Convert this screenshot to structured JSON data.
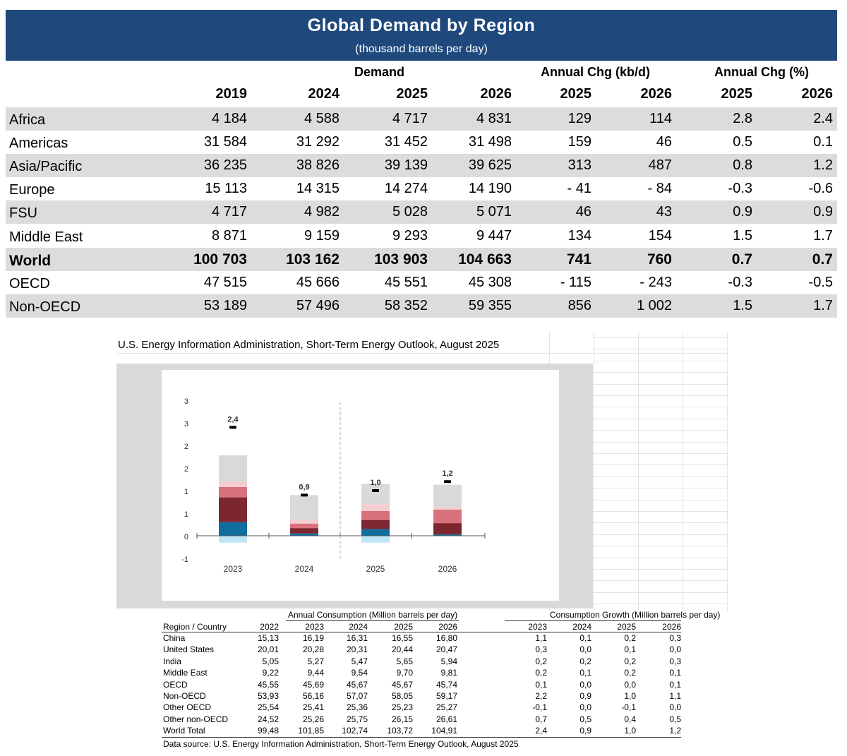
{
  "header": {
    "title": "Global Demand by Region",
    "subtitle": "(thousand barrels per day)"
  },
  "table": {
    "groups": [
      "Demand",
      "Annual Chg (kb/d)",
      "Annual Chg (%)"
    ],
    "years": [
      "2019",
      "2024",
      "2025",
      "2026",
      "2025",
      "2026",
      "2025",
      "2026"
    ],
    "rows": [
      {
        "name": "Africa",
        "vals": [
          "4 184",
          "4 588",
          "4 717",
          "4 831",
          "129",
          "114",
          "2.8",
          "2.4"
        ],
        "shade": true,
        "bold": false
      },
      {
        "name": "Americas",
        "vals": [
          "31 584",
          "31 292",
          "31 452",
          "31 498",
          "159",
          "46",
          "0.5",
          "0.1"
        ],
        "shade": false,
        "bold": false
      },
      {
        "name": "Asia/Pacific",
        "vals": [
          "36 235",
          "38 826",
          "39 139",
          "39 625",
          "313",
          "487",
          "0.8",
          "1.2"
        ],
        "shade": true,
        "bold": false
      },
      {
        "name": "Europe",
        "vals": [
          "15 113",
          "14 315",
          "14 274",
          "14 190",
          "- 41",
          "- 84",
          "-0.3",
          "-0.6"
        ],
        "shade": false,
        "bold": false
      },
      {
        "name": "FSU",
        "vals": [
          "4 717",
          "4 982",
          "5 028",
          "5 071",
          "46",
          "43",
          "0.9",
          "0.9"
        ],
        "shade": true,
        "bold": false
      },
      {
        "name": "Middle East",
        "vals": [
          "8 871",
          "9 159",
          "9 293",
          "9 447",
          "134",
          "154",
          "1.5",
          "1.7"
        ],
        "shade": false,
        "bold": false
      },
      {
        "name": "World",
        "vals": [
          "100 703",
          "103 162",
          "103 903",
          "104 663",
          "741",
          "760",
          "0.7",
          "0.7"
        ],
        "shade": true,
        "bold": true
      },
      {
        "name": "OECD",
        "vals": [
          "47 515",
          "45 666",
          "45 551",
          "45 308",
          "- 115",
          "- 243",
          "-0.3",
          "-0.5"
        ],
        "shade": false,
        "bold": false
      },
      {
        "name": "Non-OECD",
        "vals": [
          "53 189",
          "57 496",
          "58 352",
          "59 355",
          "856",
          "1 002",
          "1.5",
          "1.7"
        ],
        "shade": true,
        "bold": false
      }
    ]
  },
  "source_title": "U.S. Energy Information Administration, Short-Term Energy Outlook, August 2025",
  "chart_data": {
    "type": "bar",
    "stacked": true,
    "categories": [
      "2023",
      "2024",
      "2025",
      "2026"
    ],
    "y_tick_labels": [
      "3",
      "3",
      "2",
      "2",
      "1",
      "1",
      "0",
      "-1"
    ],
    "ylim": [
      -0.5,
      3.0
    ],
    "forecast_divider_after": "2024",
    "series_colors": [
      "#bfe6f7",
      "#0f6e9e",
      "#7b2631",
      "#d9717c",
      "#f3cdd2",
      "#d9d9d9"
    ],
    "stacks": [
      [
        -0.15,
        0.3,
        0.55,
        0.23,
        0.12,
        0.58
      ],
      [
        0.0,
        0.05,
        0.12,
        0.1,
        0.08,
        0.55
      ],
      [
        -0.15,
        0.15,
        0.2,
        0.2,
        0.15,
        0.45
      ],
      [
        0.0,
        0.03,
        0.25,
        0.3,
        0.05,
        0.5
      ]
    ],
    "totals": [
      2.4,
      0.9,
      1.0,
      1.2
    ],
    "total_labels": [
      "2,4",
      "0,9",
      "1,0",
      "1,2"
    ]
  },
  "consumption_table": {
    "left_title": "Annual Consumption (Million barrels per day)",
    "right_title": "Consumption Growth (Million barrels per day)",
    "region_header": "Region / Country",
    "left_years": [
      "2022",
      "2023",
      "2024",
      "2025",
      "2026"
    ],
    "right_years": [
      "2023",
      "2024",
      "2025",
      "2026"
    ],
    "rows": [
      {
        "name": "China",
        "cons": [
          "15,13",
          "16,19",
          "16,31",
          "16,55",
          "16,80"
        ],
        "growth": [
          "1,1",
          "0,1",
          "0,2",
          "0,3"
        ]
      },
      {
        "name": "United States",
        "cons": [
          "20,01",
          "20,28",
          "20,31",
          "20,44",
          "20,47"
        ],
        "growth": [
          "0,3",
          "0,0",
          "0,1",
          "0,0"
        ]
      },
      {
        "name": "India",
        "cons": [
          "5,05",
          "5,27",
          "5,47",
          "5,65",
          "5,94"
        ],
        "growth": [
          "0,2",
          "0,2",
          "0,2",
          "0,3"
        ]
      },
      {
        "name": "Middle East",
        "cons": [
          "9,22",
          "9,44",
          "9,54",
          "9,70",
          "9,81"
        ],
        "growth": [
          "0,2",
          "0,1",
          "0,2",
          "0,1"
        ]
      },
      {
        "name": "OECD",
        "cons": [
          "45,55",
          "45,69",
          "45,67",
          "45,67",
          "45,74"
        ],
        "growth": [
          "0,1",
          "0,0",
          "0,0",
          "0,1"
        ]
      },
      {
        "name": "Non-OECD",
        "cons": [
          "53,93",
          "56,16",
          "57,07",
          "58,05",
          "59,17"
        ],
        "growth": [
          "2,2",
          "0,9",
          "1,0",
          "1,1"
        ]
      },
      {
        "name": "Other OECD",
        "cons": [
          "25,54",
          "25,41",
          "25,36",
          "25,23",
          "25,27"
        ],
        "growth": [
          "-0,1",
          "0,0",
          "-0,1",
          "0,0"
        ]
      },
      {
        "name": "Other non-OECD",
        "cons": [
          "24,52",
          "25,26",
          "25,75",
          "26,15",
          "26,61"
        ],
        "growth": [
          "0,7",
          "0,5",
          "0,4",
          "0,5"
        ]
      },
      {
        "name": "World Total",
        "cons": [
          "99,48",
          "101,85",
          "102,74",
          "103,72",
          "104,91"
        ],
        "growth": [
          "2,4",
          "0,9",
          "1,0",
          "1,2"
        ]
      }
    ],
    "footer": "Data source: U.S. Energy Information Administration, Short-Term Energy Outlook, August 2025"
  }
}
